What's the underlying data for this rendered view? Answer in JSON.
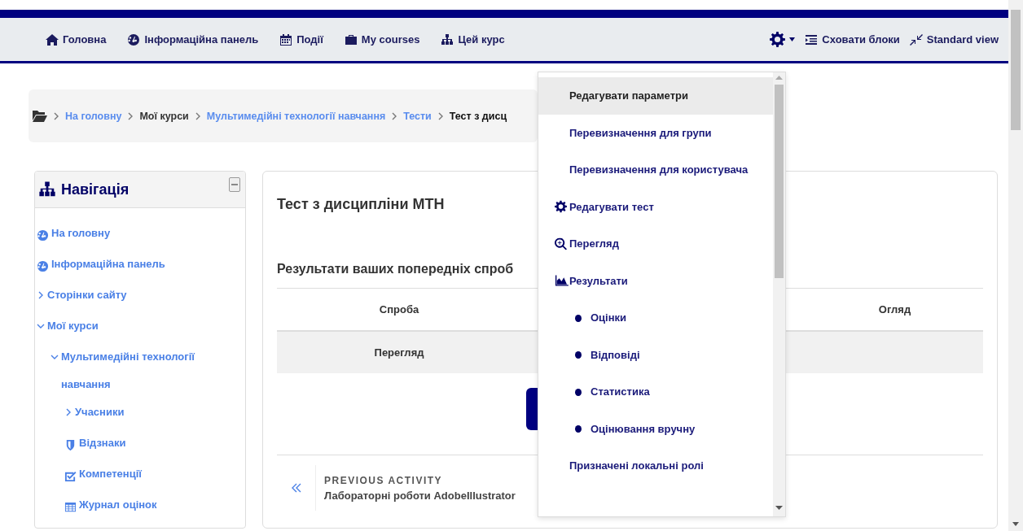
{
  "top_nav": {
    "items": [
      {
        "label": "Головна",
        "kind": "home"
      },
      {
        "label": "Інформаційна панель",
        "kind": "dashboard"
      },
      {
        "label": "Події",
        "kind": "calendar"
      },
      {
        "label": "My courses",
        "kind": "briefcase"
      },
      {
        "label": "Цей курс",
        "kind": "sitemap"
      }
    ],
    "actions": [
      {
        "label": "Сховати блоки",
        "kind": "blocks"
      },
      {
        "label": "Standard view",
        "kind": "compress"
      }
    ]
  },
  "breadcrumb": [
    {
      "label": "На головну",
      "kind": "link"
    },
    {
      "label": "Мої курси",
      "kind": "text"
    },
    {
      "label": "Мультимедійні технології навчання",
      "kind": "link"
    },
    {
      "label": "Тести",
      "kind": "link"
    },
    {
      "label": "Тест з дисц",
      "kind": "current"
    }
  ],
  "navigation": {
    "title": "Навігація",
    "items": [
      {
        "label": "На головну",
        "kind": "dashboard"
      },
      {
        "label": "Інформаційна панель",
        "kind": "dashboard"
      },
      {
        "label": "Сторінки сайту",
        "kind": "branch",
        "expanded": false
      },
      {
        "label": "Мої курси",
        "kind": "branch",
        "expanded": true,
        "children": [
          {
            "label": "Мультимедійні технології навчання",
            "kind": "branch",
            "expanded": true,
            "children": [
              {
                "label": "Учасники",
                "kind": "branch",
                "expanded": false
              },
              {
                "label": "Відзнаки",
                "kind": "shield"
              },
              {
                "label": "Компетенції",
                "kind": "check"
              },
              {
                "label": "Журнал оцінок",
                "kind": "table"
              }
            ]
          }
        ]
      }
    ]
  },
  "main": {
    "title": "Тест з дисципліни МТН",
    "section_title": "Результати ваших попередніх спроб",
    "table": {
      "columns": [
        "Спроба",
        "Огляд"
      ],
      "rows": [
        [
          "Перегляд"
        ]
      ]
    },
    "previous_activity": {
      "label": "PREVIOUS ACTIVITY",
      "title": "Лабораторні роботи AdobeIllustrator"
    }
  },
  "settings_menu": {
    "items": [
      {
        "label": "Редагувати параметри",
        "kind": "text",
        "selected": true
      },
      {
        "label": "Перевизначення для групи",
        "kind": "text",
        "selected": false
      },
      {
        "label": "Перевизначення для користувача",
        "kind": "text",
        "selected": false
      },
      {
        "label": "Редагувати тест",
        "kind": "gear",
        "selected": false
      },
      {
        "label": "Перегляд",
        "kind": "zoom",
        "selected": false
      },
      {
        "label": "Результати",
        "kind": "chart",
        "selected": false
      },
      {
        "label": "Оцінки",
        "kind": "bullet",
        "selected": false
      },
      {
        "label": "Відповіді",
        "kind": "bullet",
        "selected": false
      },
      {
        "label": "Статистика",
        "kind": "bullet",
        "selected": false
      },
      {
        "label": "Оцінювання вручну",
        "kind": "bullet",
        "selected": false
      },
      {
        "label": "Призначені локальні ролі",
        "kind": "text",
        "selected": false
      }
    ]
  }
}
